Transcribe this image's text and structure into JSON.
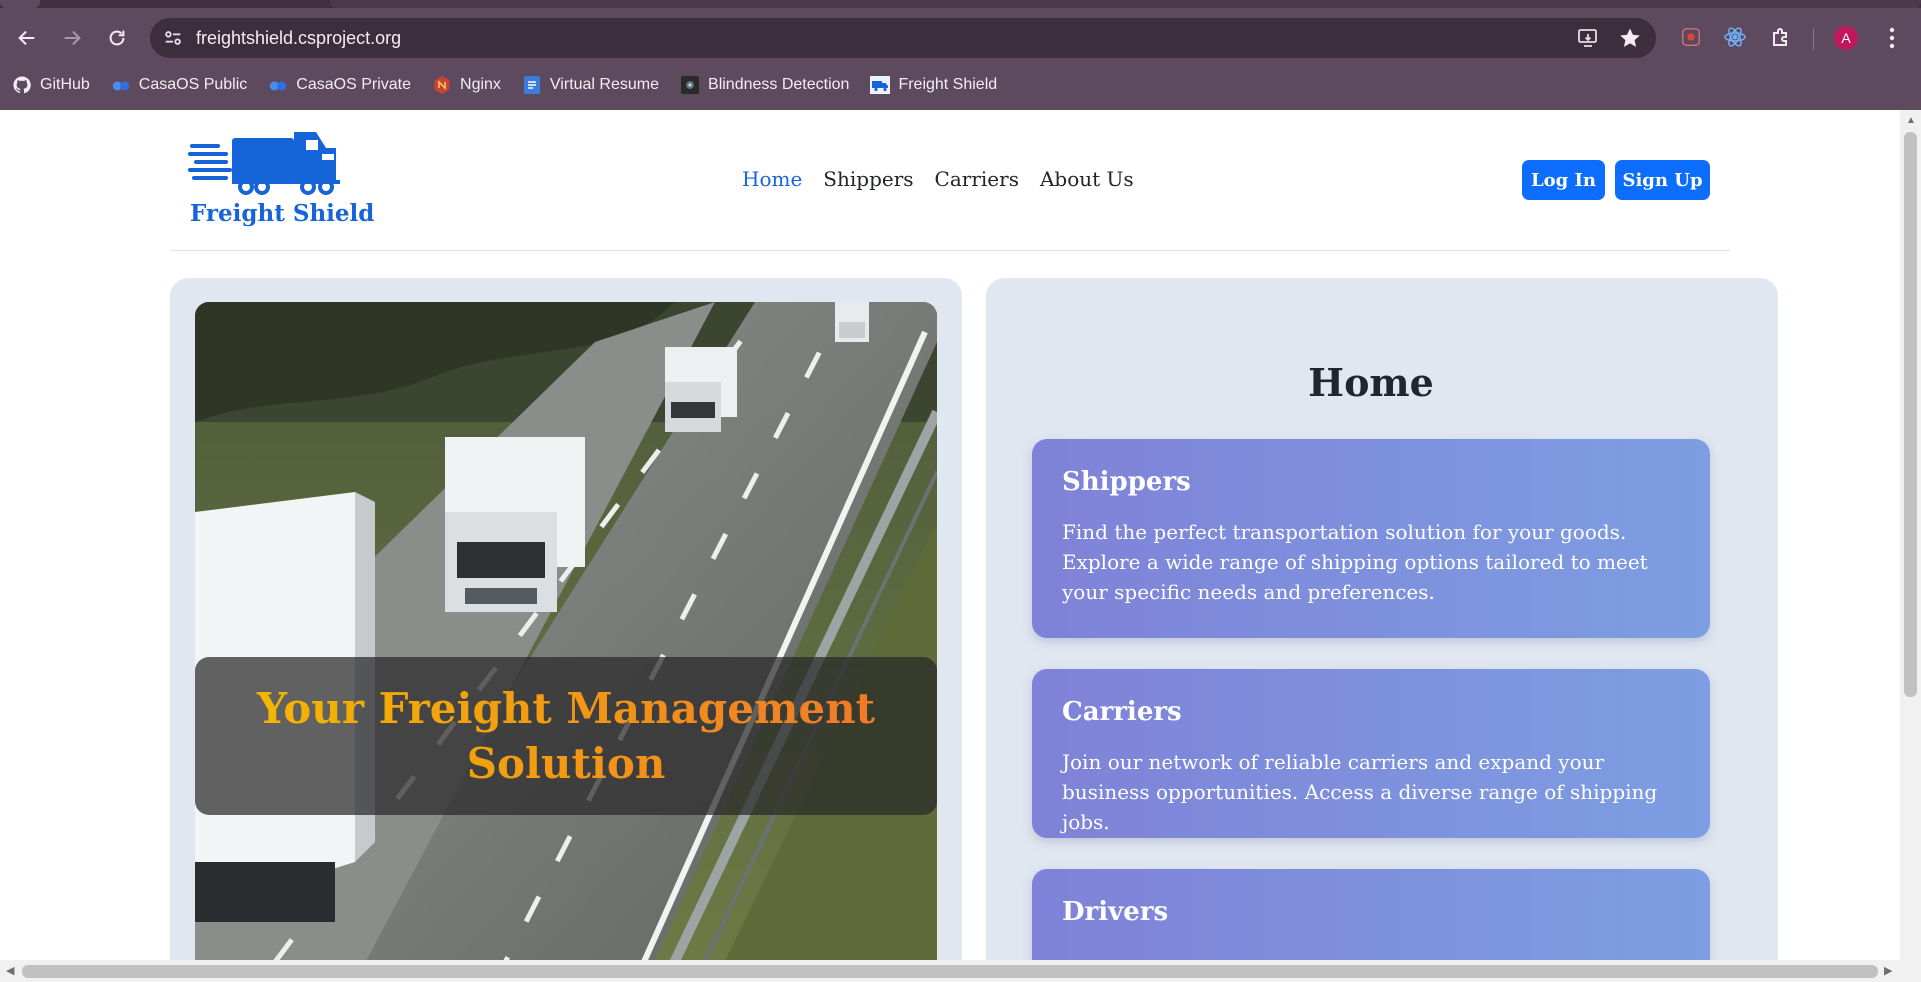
{
  "browser": {
    "url": "freightshield.csproject.org",
    "profile_initial": "A",
    "icons": {
      "back": "back-arrow-icon",
      "forward": "forward-arrow-icon",
      "reload": "reload-icon",
      "site_info": "tune-icon",
      "install": "install-app-icon",
      "bookmark": "star-icon",
      "menu": "kebab-menu-icon"
    },
    "bookmarks": [
      {
        "label": "GitHub",
        "icon": "github-icon"
      },
      {
        "label": "CasaOS Public",
        "icon": "casaos-icon"
      },
      {
        "label": "CasaOS Private",
        "icon": "casaos-icon"
      },
      {
        "label": "Nginx",
        "icon": "nginx-icon"
      },
      {
        "label": "Virtual Resume",
        "icon": "doc-icon"
      },
      {
        "label": "Blindness Detection",
        "icon": "eye-icon"
      },
      {
        "label": "Freight Shield",
        "icon": "truck-icon"
      }
    ]
  },
  "site": {
    "brand": "Freight Shield",
    "nav": [
      "Home",
      "Shippers",
      "Carriers",
      "About Us"
    ],
    "active_nav": "Home",
    "login_label": "Log In",
    "signup_label": "Sign Up"
  },
  "hero": {
    "headline": "Your Freight Management Solution"
  },
  "home": {
    "title": "Home",
    "cards": [
      {
        "title": "Shippers",
        "text": "Find the perfect transportation solution for your goods. Explore a wide range of shipping options tailored to meet your specific needs and preferences."
      },
      {
        "title": "Carriers",
        "text": "Join our network of reliable carriers and expand your business opportunities. Access a diverse range of shipping jobs."
      },
      {
        "title": "Drivers",
        "text": ""
      }
    ]
  },
  "colors": {
    "chrome": "#5e4a5f",
    "accent": "#0d6efd",
    "brand": "#1565d8",
    "panel": "#e1e7f0",
    "headline_gradient": [
      "#f3b700",
      "#f07a28"
    ],
    "card_gradient": [
      "#7f82d8",
      "#7d9ee2"
    ]
  }
}
